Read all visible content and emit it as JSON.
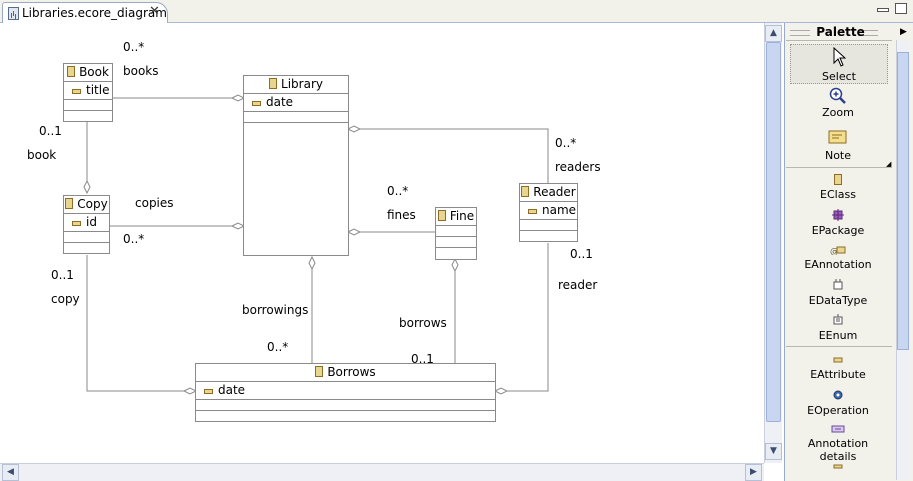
{
  "editor": {
    "tab_title": "Libraries.ecore_diagram",
    "tab_icon": "ecore-diagram-icon"
  },
  "diagram": {
    "classes": {
      "book": {
        "name": "Book",
        "attributes": [
          "title"
        ]
      },
      "library": {
        "name": "Library",
        "attributes": [
          "date"
        ]
      },
      "copy": {
        "name": "Copy",
        "attributes": [
          "id"
        ]
      },
      "fine": {
        "name": "Fine",
        "attributes": []
      },
      "reader": {
        "name": "Reader",
        "attributes": [
          "name"
        ]
      },
      "borrows": {
        "name": "Borrows",
        "attributes": [
          "date"
        ]
      }
    },
    "labels": {
      "books_mult": "0..*",
      "books": "books",
      "book_mult": "0..1",
      "book": "book",
      "copies": "copies",
      "copies_mult": "0..*",
      "copy_mult": "0..1",
      "copy": "copy",
      "fines_mult": "0..*",
      "fines": "fines",
      "readers_mult": "0..*",
      "readers": "readers",
      "reader_mult": "0..1",
      "reader": "reader",
      "borrowings": "borrowings",
      "borrowings_mult": "0..*",
      "borrows": "borrows",
      "borrows_mult": "0..1"
    }
  },
  "palette": {
    "title": "Palette",
    "tools": [
      {
        "label": "Select",
        "icon": "arrow-cursor-icon"
      },
      {
        "label": "Zoom",
        "icon": "magnifier-icon"
      },
      {
        "label": "Note",
        "icon": "note-icon"
      }
    ],
    "ecore_items": [
      {
        "label": "EClass",
        "icon": "eclass-icon"
      },
      {
        "label": "EPackage",
        "icon": "epackage-icon"
      },
      {
        "label": "EAnnotation",
        "icon": "eannotation-icon"
      },
      {
        "label": "EDataType",
        "icon": "edatatype-icon"
      },
      {
        "label": "EEnum",
        "icon": "eenum-icon"
      }
    ],
    "feature_items": [
      {
        "label": "EAttribute",
        "icon": "eattribute-icon"
      },
      {
        "label": "EOperation",
        "icon": "eoperation-icon"
      },
      {
        "label": "Annotation details",
        "icon": "annotation-details-icon"
      }
    ]
  },
  "colors": {
    "tab_border": "#9aa9c9",
    "palette_bg": "#f2f1ea",
    "class_border": "#8a8a8a",
    "class_icon": "#e8d690"
  }
}
